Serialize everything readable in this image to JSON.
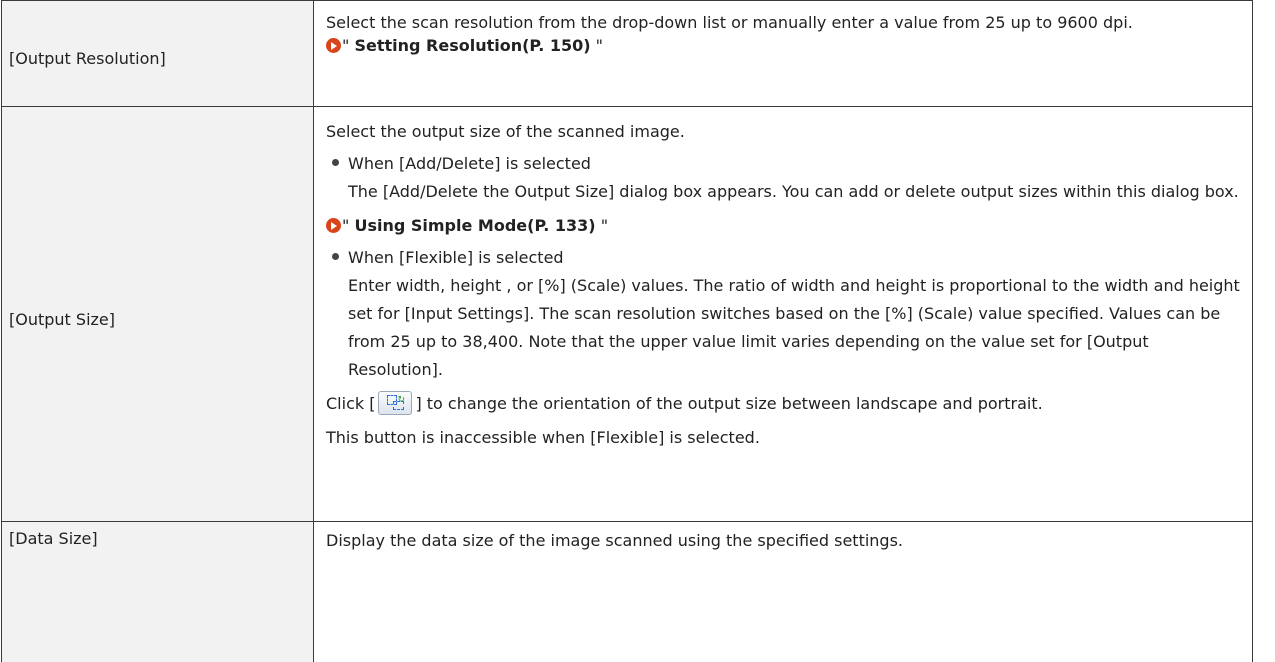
{
  "rows": [
    {
      "label": "[Output Resolution]",
      "desc": "Select the scan resolution from the drop-down list or manually enter a value from 25 up to 9600 dpi.",
      "link_text": "Setting Resolution(P. 150)"
    },
    {
      "label": "[Output Size]",
      "intro": "Select the output size of the scanned image.",
      "bullet1_title": "When [Add/Delete] is selected",
      "bullet1_body": "The [Add/Delete the Output Size] dialog box appears. You can add or delete output sizes within this dialog box.",
      "link_text": "Using Simple Mode(P. 133)",
      "bullet2_title": "When [Flexible] is selected",
      "bullet2_body": "Enter width, height , or [%] (Scale) values. The ratio of width and height is proportional to the width and height set for [Input Settings]. The scan resolution switches based on the [%] (Scale) value specified. Values can be from 25 up to 38,400. Note that the upper value limit varies depending on the value set for [Output Resolution].",
      "click_prefix": "Click [",
      "click_suffix": "] to change the orientation of the output size between landscape and portrait.",
      "button_icon": "orientation-toggle-icon",
      "note": "This button is inaccessible when [Flexible] is selected."
    },
    {
      "label": "[Data Size]",
      "desc": "Display the data size of the image scanned using the specified settings."
    }
  ],
  "link_quote": "\"",
  "colors": {
    "link_arrow": "#d9451a",
    "label_bg": "#f2f2f2",
    "border": "#3a3a3a"
  }
}
